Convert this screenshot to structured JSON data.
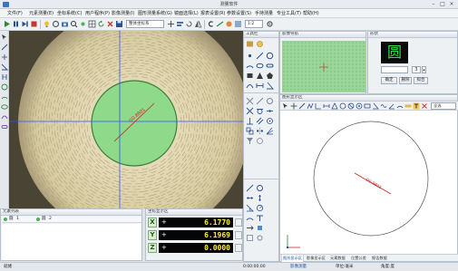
{
  "window": {
    "title": "测量软件"
  },
  "menu": {
    "items": [
      "文件(F)",
      "元素测量(E)",
      "坐标系统(C)",
      "用户程序(P)",
      "影像测量(I)",
      "图形测量系统(G)",
      "镜面选择(L)",
      "报表设置(R)",
      "参数设置(S)",
      "手持测量",
      "专业工具(T)",
      "帮助(H)"
    ]
  },
  "toolbar": {
    "dropdown_value": "整体坐标系",
    "zoom_value": "1:2"
  },
  "image_view": {
    "diameter_label": "D0.8801",
    "colors": {
      "measured_circle": "#8fd98a",
      "crosshair": "#2f55ff",
      "dim_line": "#c62828"
    }
  },
  "tool_panel": {
    "title": "工具栏"
  },
  "nav_panel": {
    "title": "影像导航"
  },
  "shape_panel": {
    "title": "形状",
    "shape_char": "圆",
    "points_label": "点数",
    "points_value": "3",
    "btn_confirm": "确定",
    "btn_delete": "删除",
    "btn_fit": "拟合"
  },
  "graph_panel": {
    "title": "图形显示区",
    "display_select": "全选",
    "diameter_label": "D0.8801",
    "tabs": [
      "图形显示区",
      "影像显示区",
      "元素数据",
      "位置公差",
      "报告数据"
    ],
    "active_tab": 0
  },
  "list_panel": {
    "title": "元素列表",
    "rows": [
      {
        "name": "圆",
        "no": "1"
      },
      {
        "name": "圆",
        "no": "2"
      }
    ]
  },
  "coord_panel": {
    "title": "坐标显示区",
    "rows": [
      {
        "axis": "X",
        "sign": "+",
        "value": "6.1770"
      },
      {
        "axis": "Y",
        "sign": "+",
        "value": "6.1969"
      },
      {
        "axis": "Z",
        "sign": "+",
        "value": "0.0000"
      }
    ]
  },
  "status": {
    "left": "就绪",
    "time": "0:00:00:00",
    "right_items": [
      "影像测量",
      "单位:毫米",
      "角度:度"
    ]
  }
}
